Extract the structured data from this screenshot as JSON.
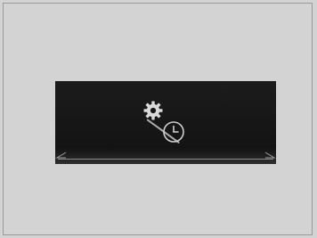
{
  "screen": {
    "icons": {
      "settings": "gear-icon",
      "clock": "clock-icon",
      "divider": "slash-divider"
    }
  },
  "colors": {
    "background": "#d3d3d3",
    "screen": "#161616",
    "icon": "#d0d0d0"
  }
}
